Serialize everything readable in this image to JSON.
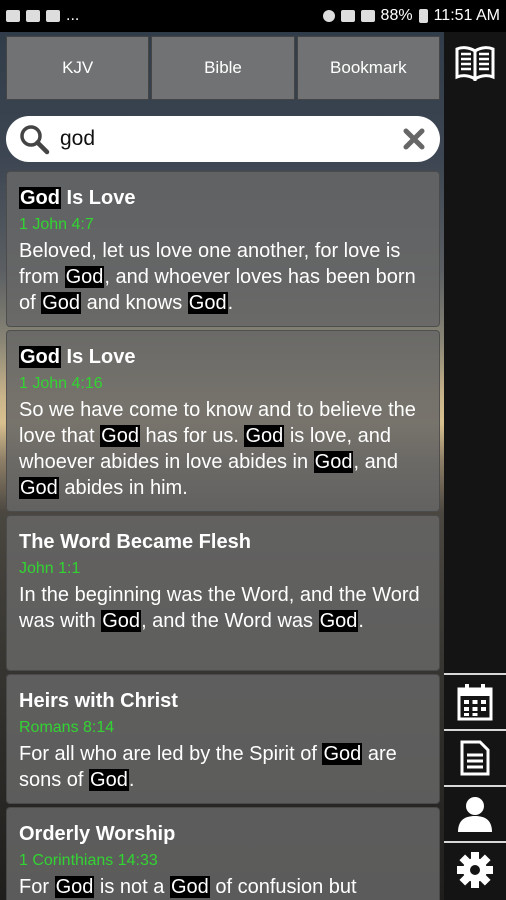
{
  "status_bar": {
    "battery": "88%",
    "time": "11:51 AM",
    "overflow": "..."
  },
  "tabs": [
    {
      "label": "KJV"
    },
    {
      "label": "Bible"
    },
    {
      "label": "Bookmark"
    }
  ],
  "search": {
    "value": "god",
    "highlight_term": "God"
  },
  "results": [
    {
      "title": [
        "God",
        " Is Love"
      ],
      "reference": "1 John 4:7",
      "text": [
        "Beloved, let us love one another, for love is from ",
        "God",
        ", and whoever loves has been born of ",
        "God",
        " and knows ",
        "God",
        "."
      ]
    },
    {
      "title": [
        "God",
        " Is Love"
      ],
      "reference": "1 John 4:16",
      "text": [
        "So we have come to know and to believe the love that ",
        "God",
        " has for us. ",
        "God",
        " is love, and whoever abides in love abides in ",
        "God",
        ", and ",
        "God",
        " abides in him."
      ]
    },
    {
      "title": [
        "The Word Became Flesh"
      ],
      "reference": "John 1:1",
      "text": [
        "In the beginning was the Word, and the Word was with ",
        "God",
        ", and the Word was ",
        "God",
        "."
      ]
    },
    {
      "title": [
        "Heirs with Christ"
      ],
      "reference": "Romans 8:14",
      "text": [
        "For all who are led by the Spirit of ",
        "God",
        " are sons of ",
        "God",
        "."
      ]
    },
    {
      "title": [
        "Orderly Worship"
      ],
      "reference": "1 Corinthians 14:33",
      "text": [
        "For ",
        "God",
        " is not a ",
        "God",
        " of confusion but"
      ]
    }
  ],
  "rail_icons": [
    "open-book-icon",
    "calendar-icon",
    "document-icon",
    "person-icon",
    "gear-icon"
  ]
}
